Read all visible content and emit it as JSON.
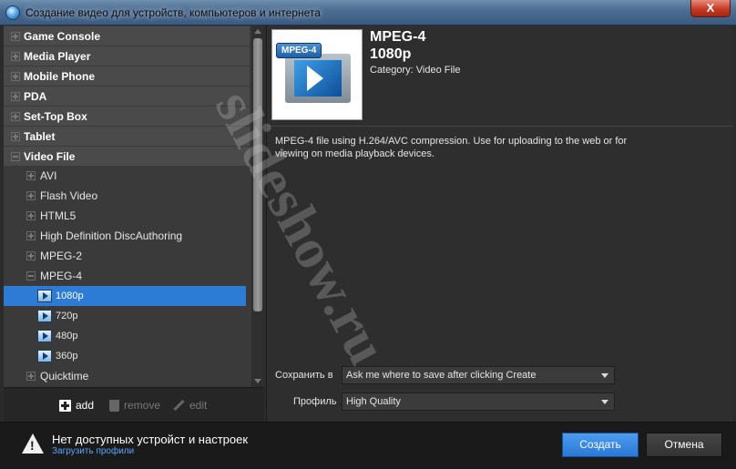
{
  "window": {
    "title": "Создание видео для устройств, компьютеров и интернета",
    "close_symbol": "X",
    "icon": "app-globe-icon"
  },
  "tree": {
    "categories": [
      {
        "label": "Game Console",
        "state": "collapsed"
      },
      {
        "label": "Media Player",
        "state": "collapsed"
      },
      {
        "label": "Mobile Phone",
        "state": "collapsed"
      },
      {
        "label": "PDA",
        "state": "collapsed"
      },
      {
        "label": "Set-Top Box",
        "state": "collapsed"
      },
      {
        "label": "Tablet",
        "state": "collapsed"
      },
      {
        "label": "Video File",
        "state": "expanded"
      }
    ],
    "video_file_children": [
      {
        "label": "AVI",
        "state": "collapsed"
      },
      {
        "label": "Flash Video",
        "state": "collapsed"
      },
      {
        "label": "HTML5",
        "state": "collapsed"
      },
      {
        "label": "High Definition DiscAuthoring",
        "state": "collapsed"
      },
      {
        "label": "MPEG-2",
        "state": "collapsed"
      },
      {
        "label": "MPEG-4",
        "state": "expanded"
      }
    ],
    "mpeg4_profiles": [
      {
        "label": "1080p",
        "selected": true
      },
      {
        "label": "720p",
        "selected": false
      },
      {
        "label": "480p",
        "selected": false
      },
      {
        "label": "360p",
        "selected": false
      }
    ],
    "after_profiles": {
      "label": "Quicktime",
      "state": "collapsed"
    }
  },
  "toolbar": {
    "add_label": "add",
    "remove_label": "remove",
    "edit_label": "edit"
  },
  "profile": {
    "badge": "MPEG-4",
    "name": "MPEG-4",
    "resolution": "1080p",
    "category": "Category: Video File",
    "description": "MPEG-4 file using H.264/AVC compression. Use for uploading to the web or for viewing on media playback devices."
  },
  "settings": {
    "save_label": "Сохранить в",
    "save_value": "Ask me where to save after clicking Create",
    "profile_label": "Профиль",
    "profile_value": "High Quality"
  },
  "watermark": "slideshow.ru",
  "footer": {
    "message": "Нет доступных устройст и настроек",
    "link": "Загрузить профили",
    "create_label": "Создать",
    "cancel_label": "Отмена"
  },
  "colors": {
    "selection": "#2e7bd6",
    "primary_button": "#2a78d6",
    "link": "#5aa6ff"
  }
}
